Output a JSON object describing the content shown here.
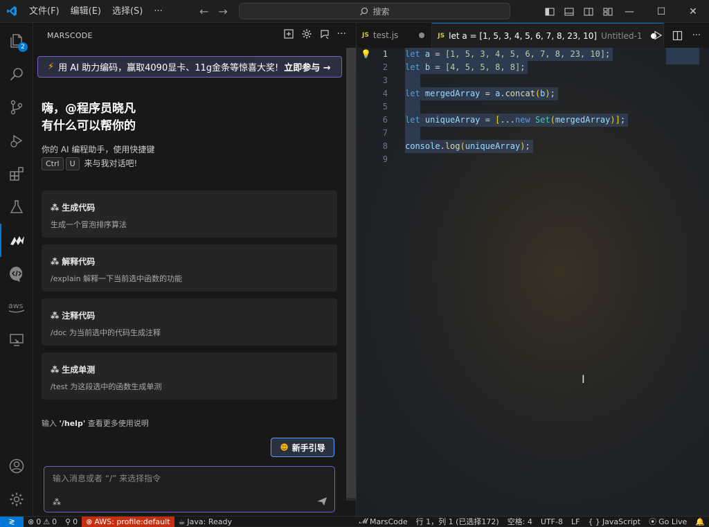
{
  "titlebar": {
    "menus": [
      "文件(F)",
      "编辑(E)",
      "选择(S)",
      "···"
    ],
    "search_label": "搜索"
  },
  "activity": {
    "explorer_badge": "2"
  },
  "sidebar": {
    "title": "MARSCODE",
    "banner": {
      "text": "用 AI 助力编码，赢取4090显卡、11g金条等惊喜大奖!",
      "cta": "立即参与 →"
    },
    "greeting_line1": "嗨，@程序员晓凡",
    "greeting_line2": "有什么可以帮你的",
    "assistant_line1": "你的 AI 编程助手，使用快捷键",
    "key_ctrl": "Ctrl",
    "key_u": "U",
    "assistant_line2": "来与我对话吧!",
    "cards": [
      {
        "title": "生成代码",
        "desc": "生成一个冒泡排序算法"
      },
      {
        "title": "解释代码",
        "desc": "/explain 解释一下当前选中函数的功能"
      },
      {
        "title": "注释代码",
        "desc": "/doc 为当前选中的代码生成注释"
      },
      {
        "title": "生成单测",
        "desc": "/test 为这段选中的函数生成单测"
      }
    ],
    "help_prefix": "输入 ",
    "help_cmd": "'/help'",
    "help_suffix": " 查看更多使用说明",
    "guide_button": "新手引导",
    "chat_placeholder": "输入消息或者 “/” 来选择指令"
  },
  "editor": {
    "tabs": [
      {
        "icon": "JS",
        "label": "test.js",
        "desc": ""
      },
      {
        "icon": "JS",
        "label": "let a = [1, 5, 3, 4, 5, 6, 7, 8, 23, 10]",
        "desc": "Untitled-1"
      }
    ],
    "line_numbers": [
      "1",
      "2",
      "3",
      "4",
      "5",
      "6",
      "7",
      "8",
      "9"
    ],
    "code": {
      "l1_kw": "let",
      "l1_var": "a",
      "l1_vals": "[1, 5, 3, 4, 5, 6, 7, 8, 23, 10]",
      "l2_kw": "let",
      "l2_var": "b",
      "l2_vals": "[4, 5, 5, 8, 8]",
      "l4_kw": "let",
      "l4_var": "mergedArray",
      "l4_obj": "a",
      "l4_fn": "concat",
      "l4_arg": "b",
      "l6_kw": "let",
      "l6_var": "uniqueArray",
      "l6_new": "new",
      "l6_cls": "Set",
      "l6_arg": "mergedArray",
      "l8_obj": "console",
      "l8_fn": "log",
      "l8_arg": "uniqueArray"
    }
  },
  "statusbar": {
    "problems": "0",
    "warnings": "0",
    "ports": "0",
    "aws": "AWS: profile:default",
    "java": "Java: Ready",
    "marscode": "MarsCode",
    "position": "行 1，列 1 (已选择172)",
    "spaces": "空格: 4",
    "encoding": "UTF-8",
    "eol": "LF",
    "language": "JavaScript",
    "golive": "Go Live"
  },
  "colors": {
    "accent": "#0078d4",
    "banner_border": "#7a5cc9",
    "aws_bg": "#c72e0f"
  }
}
